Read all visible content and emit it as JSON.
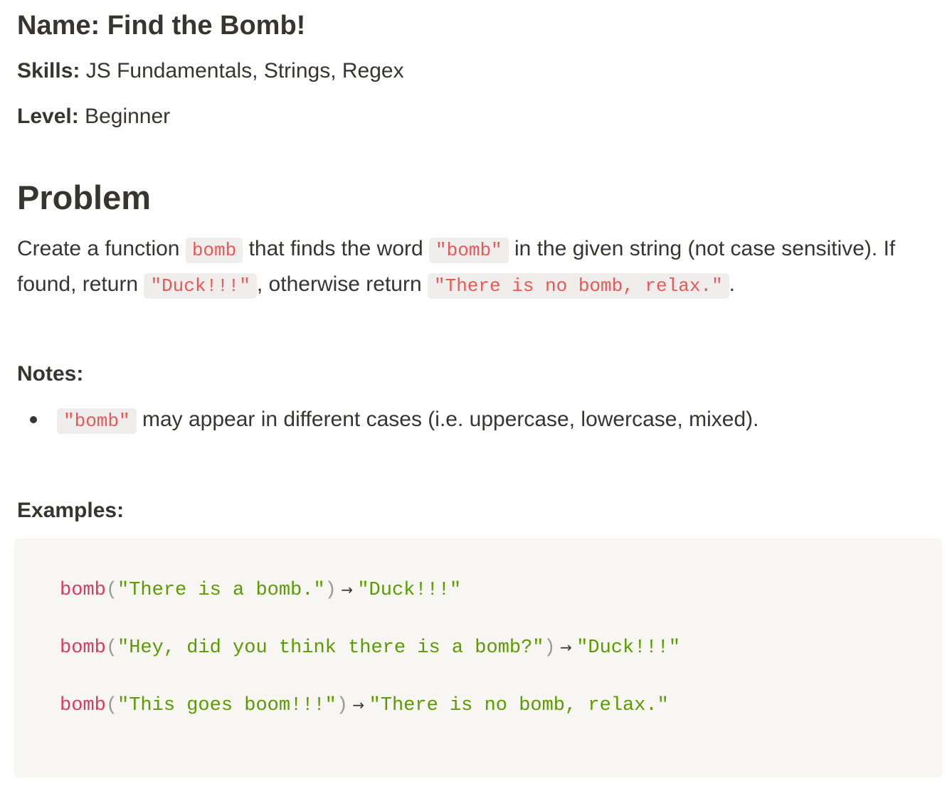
{
  "meta": {
    "name_label": "Name:",
    "name_value": "Find the Bomb!",
    "skills_label": "Skills:",
    "skills_value": "JS Fundamentals, Strings, Regex",
    "level_label": "Level:",
    "level_value": "Beginner"
  },
  "problem": {
    "heading": "Problem",
    "text_1": "Create a function ",
    "code_1": "bomb",
    "text_2": " that finds the word ",
    "code_2": "\"bomb\"",
    "text_3": " in the given string (not case sensitive). If found, return ",
    "code_3": "\"Duck!!!\"",
    "text_4": ", otherwise return ",
    "code_4": "\"There is no bomb, relax.\"",
    "text_5": "."
  },
  "notes": {
    "heading": "Notes:",
    "items": [
      {
        "code": "\"bomb\"",
        "text": " may appear in different cases (i.e. uppercase, lowercase, mixed)."
      }
    ]
  },
  "examples": {
    "heading": "Examples:",
    "lines": [
      {
        "fn": "bomb",
        "open": "(",
        "arg": "\"There is a bomb.\"",
        "close": ")",
        "arrow": " → ",
        "result": "\"Duck!!!\""
      },
      {
        "fn": "bomb",
        "open": "(",
        "arg": "\"Hey, did you think there is a bomb?\"",
        "close": ")",
        "arrow": " → ",
        "result": "\"Duck!!!\""
      },
      {
        "fn": "bomb",
        "open": "(",
        "arg": "\"This goes boom!!!\"",
        "close": ")",
        "arrow": " → ",
        "result": "\"There is no bomb, relax.\""
      }
    ]
  }
}
